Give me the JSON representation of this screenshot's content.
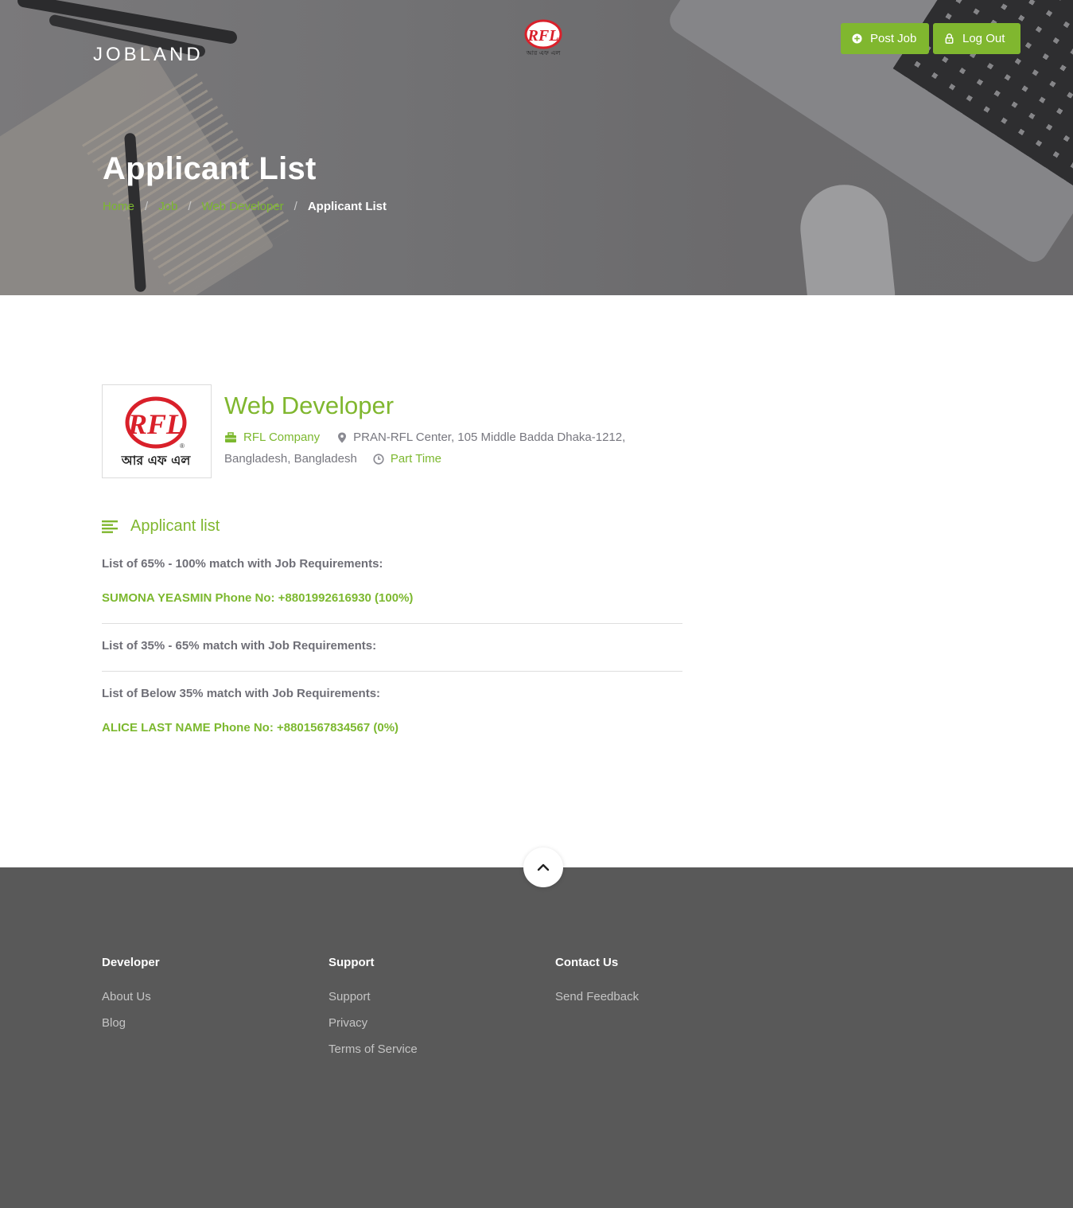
{
  "header": {
    "brand": "JOBLAND",
    "post_job_label": "Post Job",
    "logout_label": "Log Out"
  },
  "hero": {
    "title": "Applicant List",
    "breadcrumb": [
      "Home",
      "Job",
      "Web Developer",
      "Applicant List"
    ]
  },
  "job": {
    "title": "Web Developer",
    "company": "RFL Company",
    "address_line1": "PRAN-RFL Center, 105 Middle Badda Dhaka-1212,",
    "address_line2": "Bangladesh, Bangladesh",
    "type": "Part Time"
  },
  "applicants": {
    "heading": "Applicant list",
    "groups": [
      {
        "label": "List of 65% - 100% match with Job Requirements:",
        "items": [
          "SUMONA YEASMIN Phone No: +8801992616930 (100%)"
        ]
      },
      {
        "label": "List of 35% - 65% match with Job Requirements:",
        "items": []
      },
      {
        "label": "List of Below 35% match with Job Requirements:",
        "items": [
          "ALICE LAST NAME Phone No: +8801567834567 (0%)"
        ]
      }
    ]
  },
  "footer": {
    "columns": [
      {
        "title": "Developer",
        "links": [
          "About Us",
          "Blog"
        ]
      },
      {
        "title": "Support",
        "links": [
          "Support",
          "Privacy",
          "Terms of Service"
        ]
      },
      {
        "title": "Contact Us",
        "links": [
          "Send Feedback"
        ]
      }
    ]
  },
  "logo": {
    "mark": "RFL",
    "bengali": "আর এফ এল"
  },
  "colors": {
    "accent": "#80b72f",
    "footer_bg": "#595959",
    "text_muted": "#6f6f77"
  }
}
